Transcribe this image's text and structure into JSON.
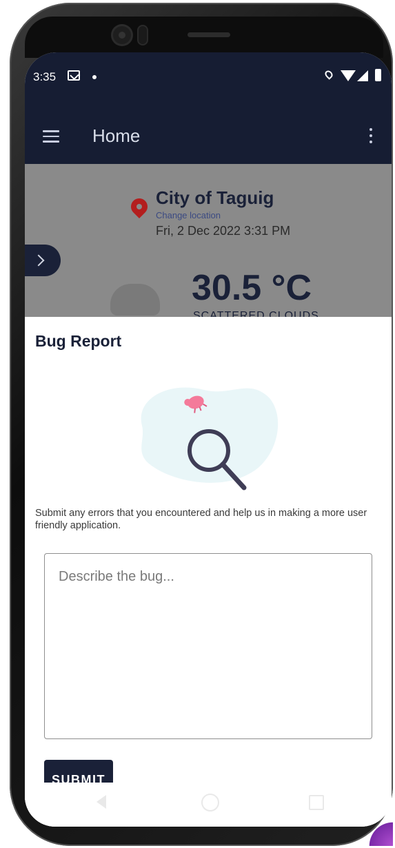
{
  "status_bar": {
    "time": "3:35"
  },
  "appbar": {
    "title": "Home"
  },
  "location": {
    "city": "City of Taguig",
    "change_label": "Change location",
    "datetime": "Fri, 2 Dec 2022 3:31 PM"
  },
  "weather": {
    "temperature": "30.5 °C",
    "condition": "SCATTERED CLOUDS"
  },
  "bug_report": {
    "title": "Bug Report",
    "description": "Submit any errors that you encountered and help us in making a more user friendly application.",
    "placeholder": "Describe the bug...",
    "submit_label": "SUBMIT"
  },
  "colors": {
    "primary": "#161d33",
    "pin": "#b31e1e",
    "blob": "#e9f6f8",
    "bug": "#f47a9a"
  }
}
